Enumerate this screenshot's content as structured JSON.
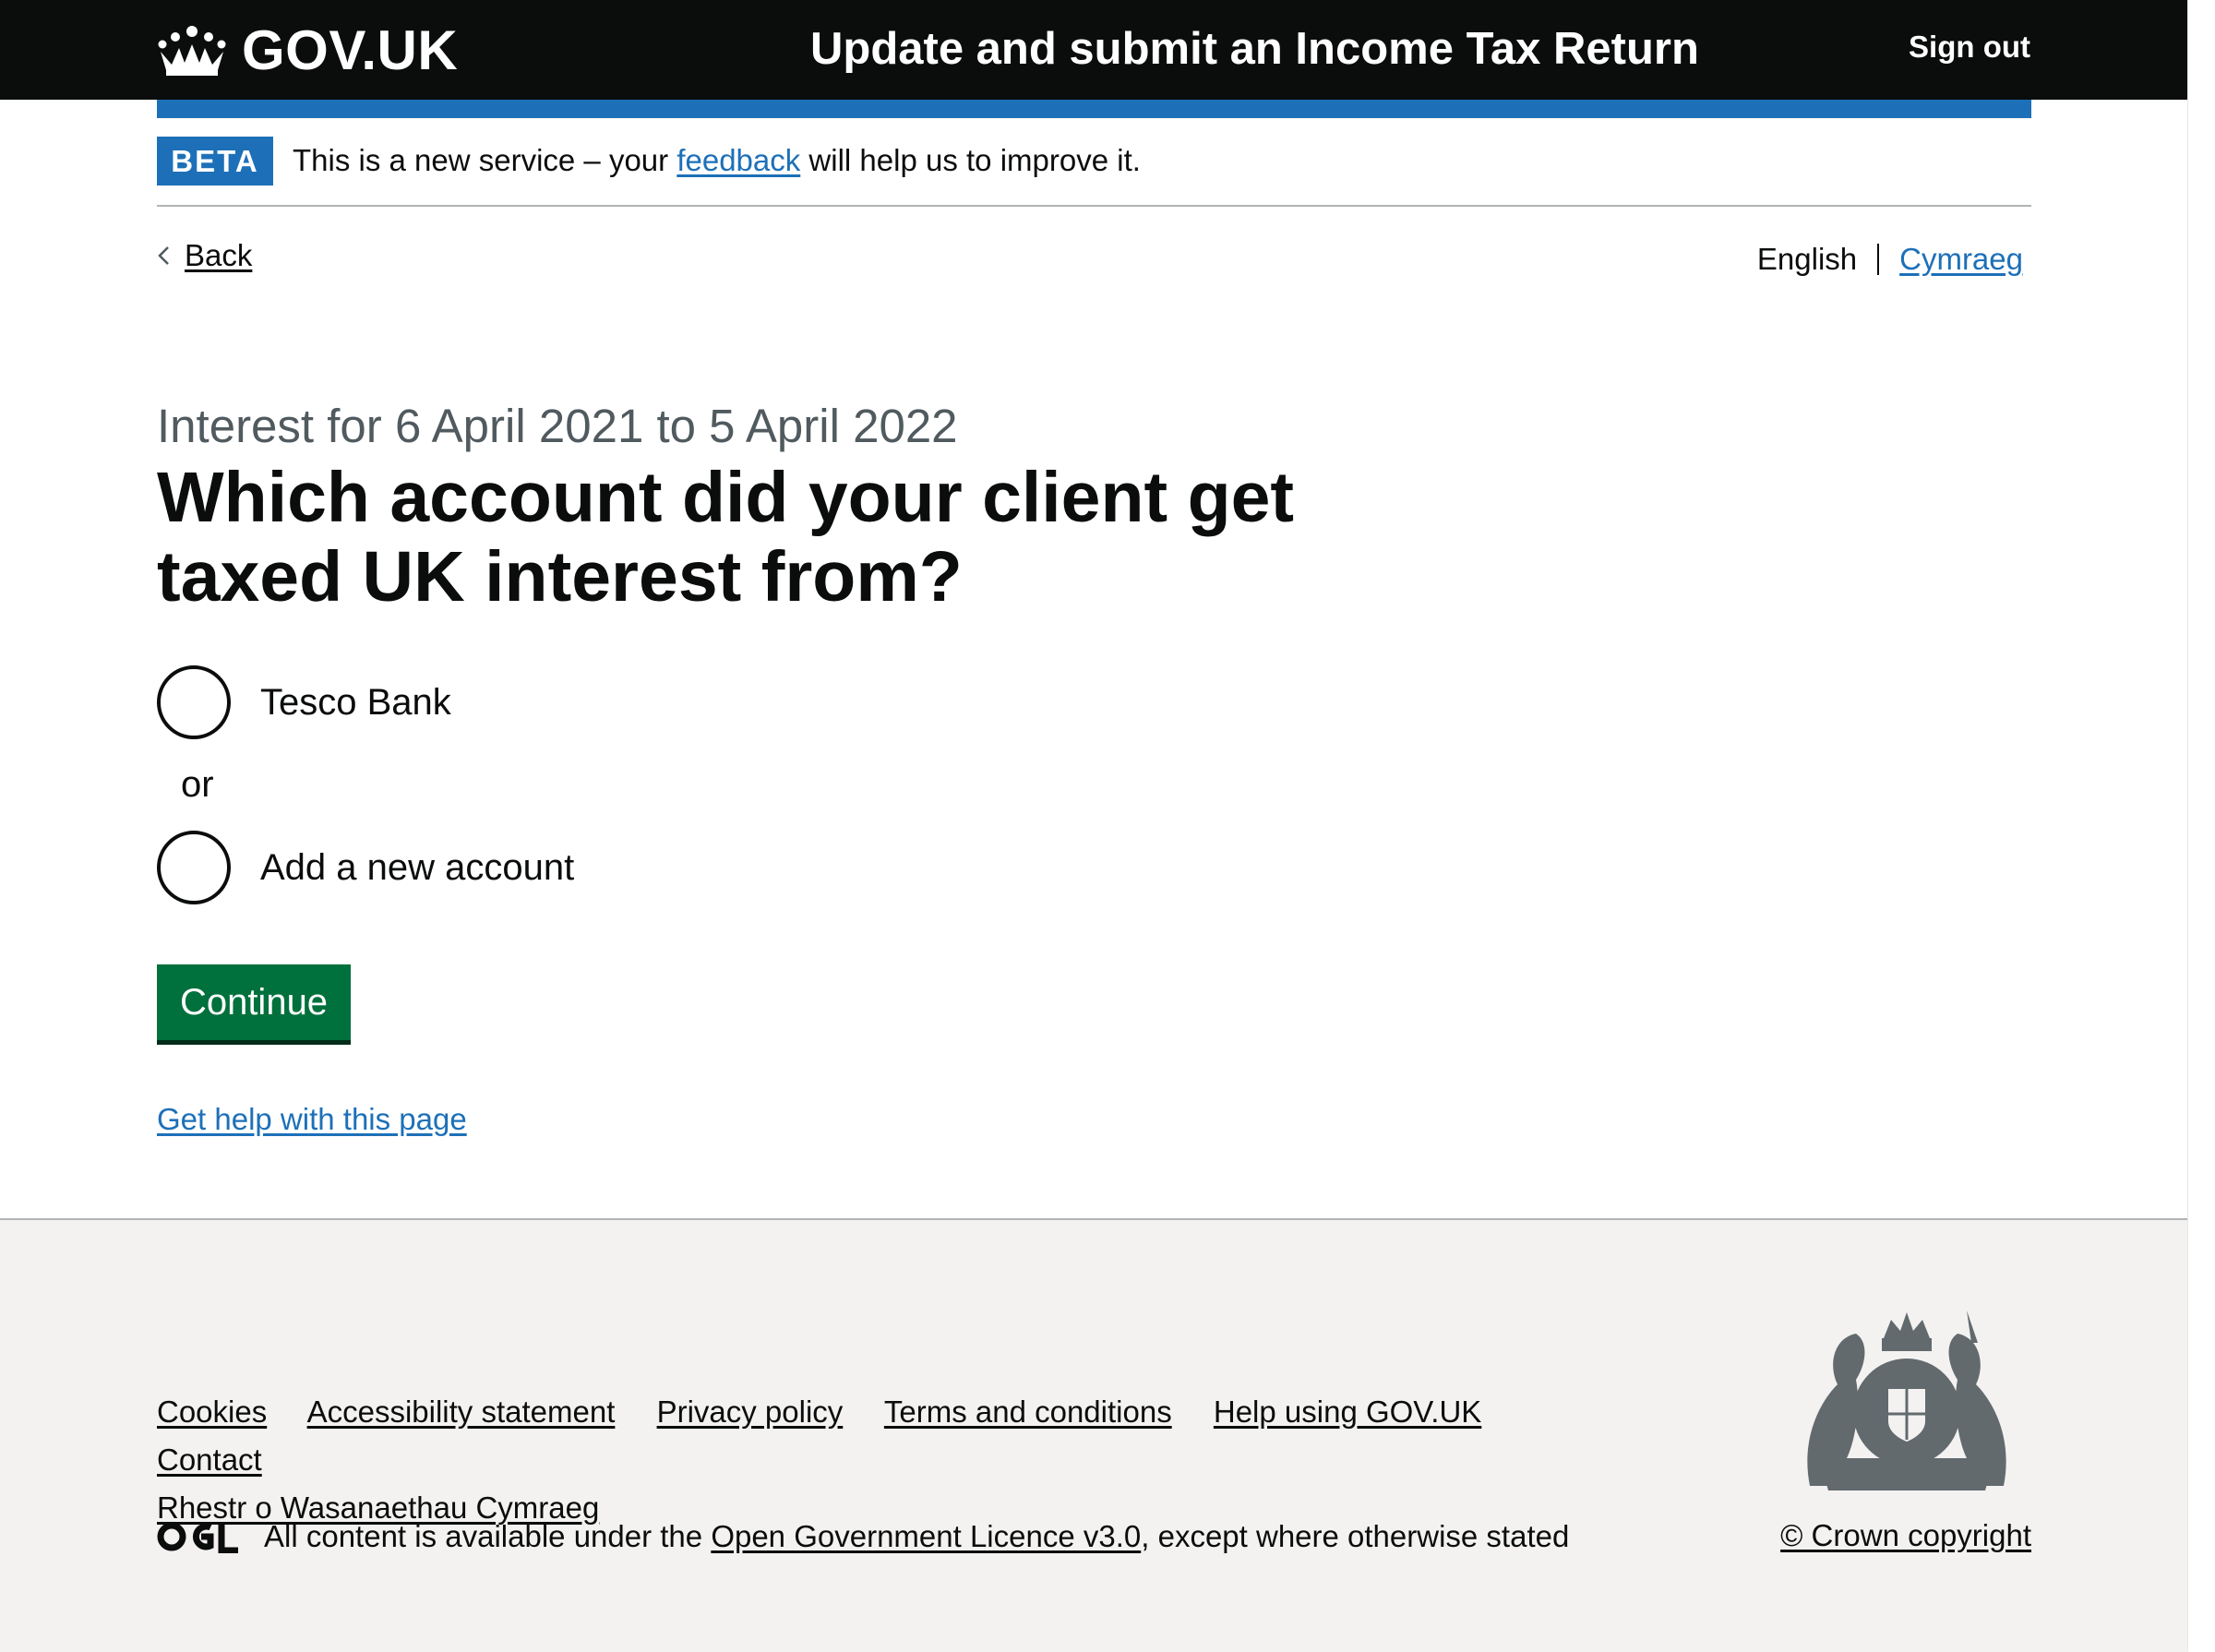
{
  "header": {
    "logo_text": "GOV.UK",
    "service_name": "Update and submit an Income Tax Return",
    "sign_out": "Sign out"
  },
  "phase_banner": {
    "tag": "BETA",
    "text_before": "This is a new service – your ",
    "link": "feedback",
    "text_after": " will help us to improve it."
  },
  "nav": {
    "back": "Back",
    "lang_current": "English",
    "lang_other": "Cymraeg"
  },
  "main": {
    "caption": "Interest for 6 April 2021 to 5 April 2022",
    "heading": "Which account did your client get taxed UK interest from?",
    "options": [
      {
        "label": "Tesco Bank"
      },
      {
        "label": "Add a new account"
      }
    ],
    "divider": "or",
    "continue": "Continue",
    "help_link": "Get help with this page"
  },
  "footer": {
    "links": [
      "Cookies",
      "Accessibility statement",
      "Privacy policy",
      "Terms and conditions",
      "Help using GOV.UK",
      "Contact",
      "Rhestr o Wasanaethau Cymraeg"
    ],
    "licence_before": "All content is available under the ",
    "licence_link": "Open Government Licence v3.0",
    "licence_after": ", except where otherwise stated",
    "copyright": "© Crown copyright"
  },
  "colors": {
    "header_bg": "#0b0c0c",
    "brand_blue": "#1d70b8",
    "button_green": "#00703c",
    "footer_bg": "#f3f2f1",
    "caption_grey": "#505a5f"
  }
}
